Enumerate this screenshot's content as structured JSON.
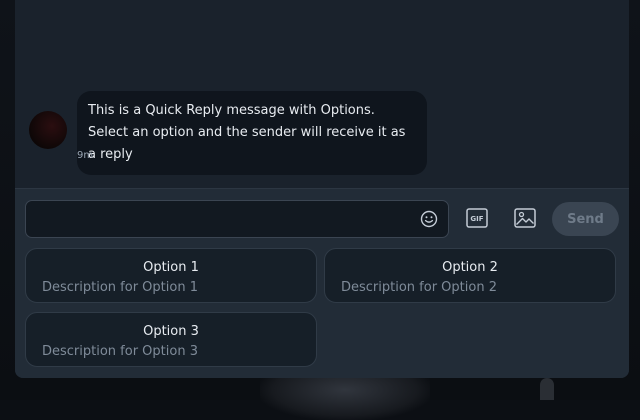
{
  "message": {
    "text": "This is a Quick Reply message with Options. Select an option and the sender will receive it as a reply",
    "time": "9m"
  },
  "composer": {
    "input_value": "",
    "input_placeholder": "",
    "gif_label": "GIF",
    "send_label": "Send"
  },
  "options": [
    {
      "title": "Option 1",
      "description": "Description for Option 1"
    },
    {
      "title": "Option 2",
      "description": "Description for Option 2"
    },
    {
      "title": "Option 3",
      "description": "Description for Option 3"
    }
  ],
  "icons": {
    "emoji": "emoji-icon",
    "gif": "gif-icon",
    "image": "image-icon"
  },
  "colors": {
    "panel": "#1a222c",
    "bubble": "#0f151d",
    "send_disabled": "#3a4552",
    "option_bg": "#161f28"
  }
}
